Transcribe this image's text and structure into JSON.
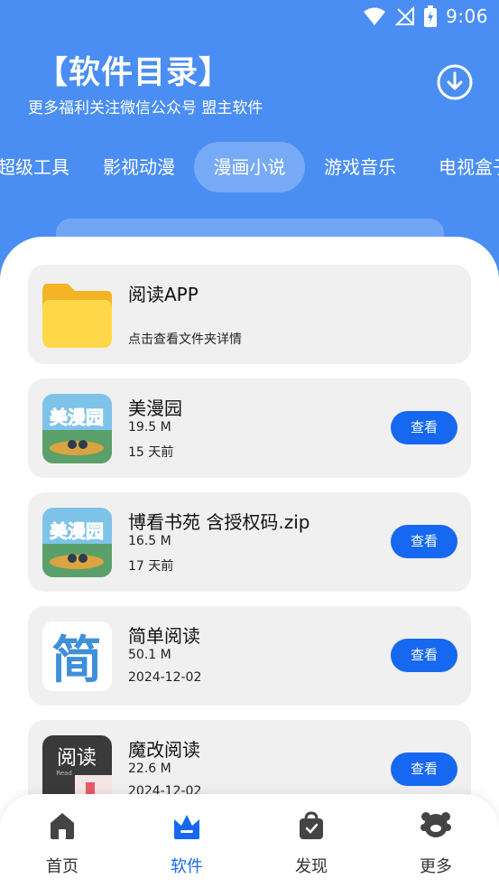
{
  "status_bar": {
    "time": "9:06"
  },
  "header": {
    "title": "【软件目录】",
    "subtitle": "更多福利关注微信公众号 盟主软件"
  },
  "tabs": [
    {
      "label": "超级工具"
    },
    {
      "label": "影视动漫"
    },
    {
      "label": "漫画小说",
      "active": true
    },
    {
      "label": "游戏音乐"
    },
    {
      "label": "电视盒子"
    }
  ],
  "list": {
    "folder": {
      "name": "阅读APP",
      "hint": "点击查看文件夹详情"
    },
    "items": [
      {
        "name": "美漫园",
        "size": "19.5 M",
        "date": "15 天前",
        "button": "查看"
      },
      {
        "name": "博看书苑 含授权码.zip",
        "size": "16.5 M",
        "date": "17 天前",
        "button": "查看"
      },
      {
        "name": "简单阅读",
        "size": "50.1 M",
        "date": "2024-12-02",
        "button": "查看"
      },
      {
        "name": "魔改阅读",
        "size": "22.6 M",
        "date": "2024-12-02",
        "button": "查看"
      }
    ],
    "thumb_text": {
      "meiman": "美漫园",
      "jian": "简",
      "yuedu": "阅读",
      "read": "Read"
    }
  },
  "bottom_nav": [
    {
      "label": "首页",
      "icon": "home-icon"
    },
    {
      "label": "软件",
      "icon": "crown-icon",
      "active": true
    },
    {
      "label": "发现",
      "icon": "bag-icon"
    },
    {
      "label": "更多",
      "icon": "bear-icon"
    }
  ],
  "colors": {
    "accent": "#1668f0",
    "header_bg": "#4a8ef3",
    "card_bg": "#f0f0f0"
  }
}
